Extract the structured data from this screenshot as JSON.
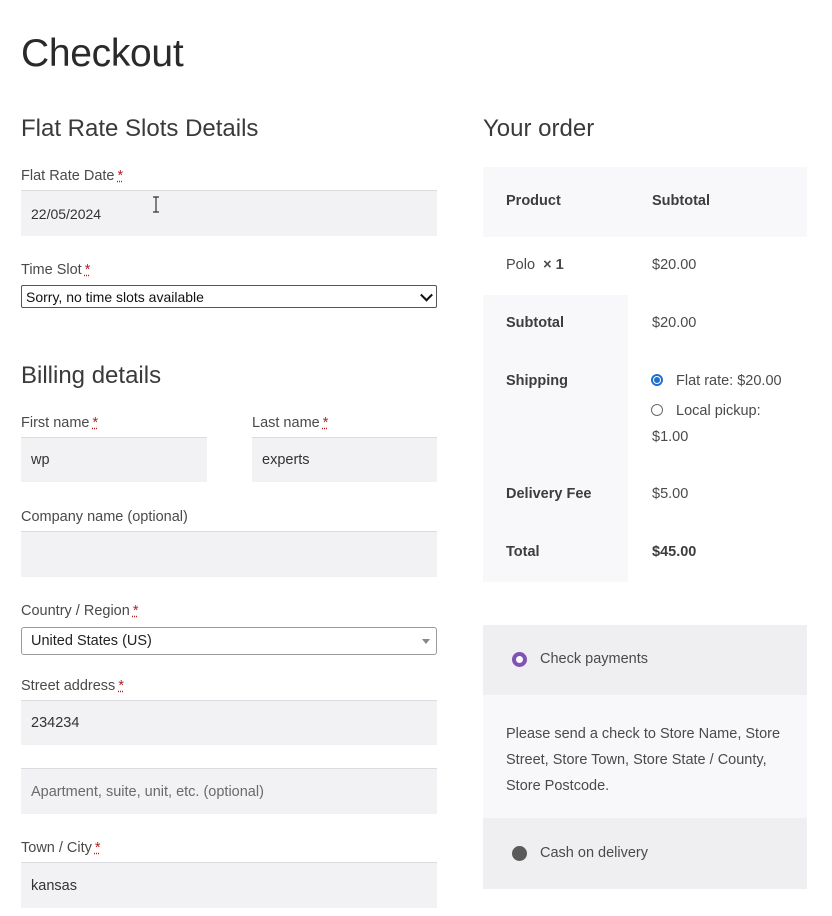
{
  "page": {
    "title": "Checkout"
  },
  "slots": {
    "heading": "Flat Rate Slots Details",
    "date_label": "Flat Rate Date",
    "date_value": "22/05/2024",
    "time_label": "Time Slot",
    "time_value": "Sorry, no time slots available"
  },
  "billing": {
    "heading": "Billing details",
    "first_name_label": "First name",
    "first_name_value": "wp",
    "last_name_label": "Last name",
    "last_name_value": "experts",
    "company_label": "Company name (optional)",
    "company_value": "",
    "country_label": "Country / Region",
    "country_value": "United States (US)",
    "street_label": "Street address",
    "street_value": "234234",
    "apartment_placeholder": "Apartment, suite, unit, etc. (optional)",
    "city_label": "Town / City",
    "city_value": "kansas",
    "required_mark": "*"
  },
  "order": {
    "heading": "Your order",
    "col_product": "Product",
    "col_subtotal": "Subtotal",
    "item_name": "Polo",
    "item_qty": "× 1",
    "item_price": "$20.00",
    "subtotal_label": "Subtotal",
    "subtotal_value": "$20.00",
    "shipping_label": "Shipping",
    "shipping_option_1": "Flat rate: $20.00",
    "shipping_option_2_line1": "Local pickup:",
    "shipping_option_2_line2": "$1.00",
    "shipping_selected": "Flat rate: $20.00",
    "fee_label": "Delivery Fee",
    "fee_value": "$5.00",
    "total_label": "Total",
    "total_value": "$45.00"
  },
  "payment": {
    "check_label": "Check payments",
    "check_description": "Please send a check to Store Name, Store Street, Store Town, Store State / County, Store Postcode.",
    "cod_label": "Cash on delivery",
    "selected": "Check payments",
    "accent_color": "#7f54b3"
  }
}
